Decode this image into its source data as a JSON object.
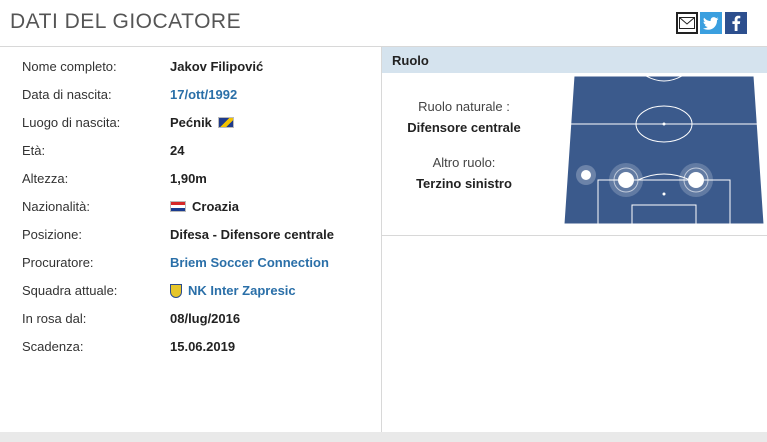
{
  "header": {
    "title": "DATI DEL GIOCATORE",
    "social": [
      "mail-icon",
      "twitter-icon",
      "facebook-icon"
    ]
  },
  "player": {
    "rows": [
      {
        "label": "Nome completo:",
        "value": "Jakov Filipović"
      },
      {
        "label": "Data di nascita:",
        "value": "17/ott/1992"
      },
      {
        "label": "Luogo di nascita:",
        "value": "Pećnik"
      },
      {
        "label": "Età:",
        "value": "24"
      },
      {
        "label": "Altezza:",
        "value": "1,90m"
      },
      {
        "label": "Nazionalità:",
        "value": "Croazia"
      },
      {
        "label": "Posizione:",
        "value": "Difesa - Difensore centrale"
      },
      {
        "label": "Procuratore:",
        "value": "Briem Soccer Connection"
      },
      {
        "label": "Squadra attuale:",
        "value": "NK Inter Zapresic"
      },
      {
        "label": "In rosa dal:",
        "value": "08/lug/2016"
      },
      {
        "label": "Scadenza:",
        "value": "15.06.2019"
      }
    ]
  },
  "role": {
    "header": "Ruolo",
    "natural_label": "Ruolo naturale :",
    "natural_value": "Difensore centrale",
    "other_label": "Altro ruolo:",
    "other_value": "Terzino sinistro"
  },
  "colors": {
    "link": "#2a6fa8",
    "role_header_bg": "#d5e3ee",
    "pitch": "#3b5a8c"
  }
}
